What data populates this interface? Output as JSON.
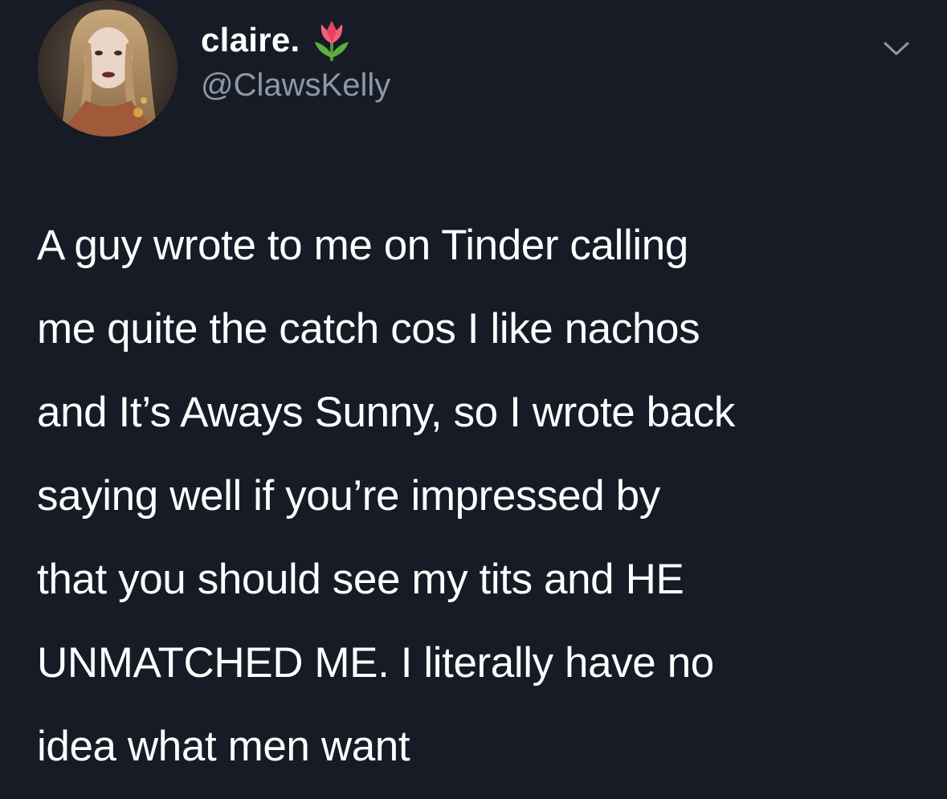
{
  "author": {
    "display_name": "claire.",
    "handle": "@ClawsKelly"
  },
  "tweet": {
    "lines": [
      "A guy wrote to me on Tinder calling",
      "me quite the catch cos I like nachos",
      "and It’s Aways Sunny, so I wrote back",
      "saying well if you’re impressed by",
      "that you should see my tits and HE",
      "UNMATCHED ME. I literally have no",
      "idea what men want"
    ]
  },
  "icons": {
    "emoji": "tulip-icon",
    "menu": "chevron-down-icon"
  },
  "colors": {
    "background": "#161b25",
    "text_primary": "#ffffff",
    "text_secondary": "#8b98a5"
  }
}
